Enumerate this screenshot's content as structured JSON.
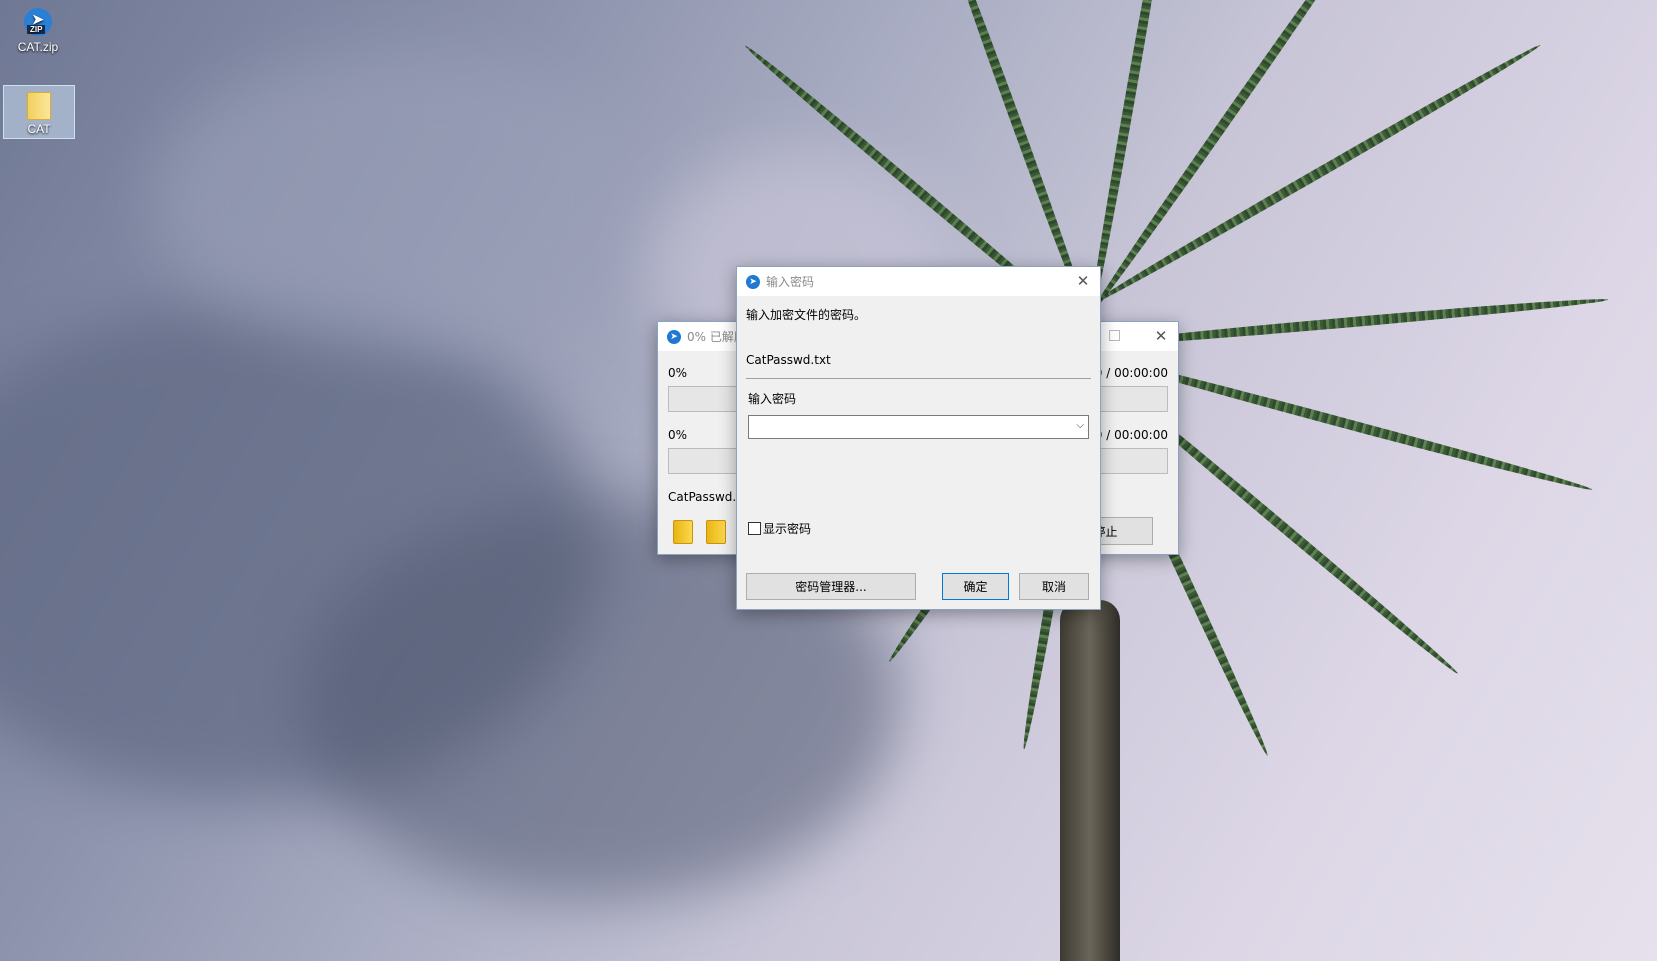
{
  "desktop": {
    "icons": [
      {
        "label": "CAT.zip",
        "icon": "zip-archive-icon"
      },
      {
        "label": "CAT",
        "icon": "folder-icon"
      }
    ]
  },
  "progress_window": {
    "title": "0% 已解压",
    "progress1_label": "0%",
    "progress1_time": "00:00:00 / 00:00:00",
    "progress1_value": 0,
    "progress2_label": "0%",
    "progress2_time": "00:00:00 / 00:00:00",
    "progress2_value": 0,
    "current_file": "CatPasswd.txt",
    "stop_label": "停止"
  },
  "password_dialog": {
    "title": "输入密码",
    "prompt": "输入加密文件的密码。",
    "file_name": "CatPasswd.txt",
    "password_label": "输入密码",
    "password_value": "",
    "show_password_label": "显示密码",
    "show_password_checked": false,
    "password_manager_label": "密码管理器...",
    "ok_label": "确定",
    "cancel_label": "取消"
  }
}
